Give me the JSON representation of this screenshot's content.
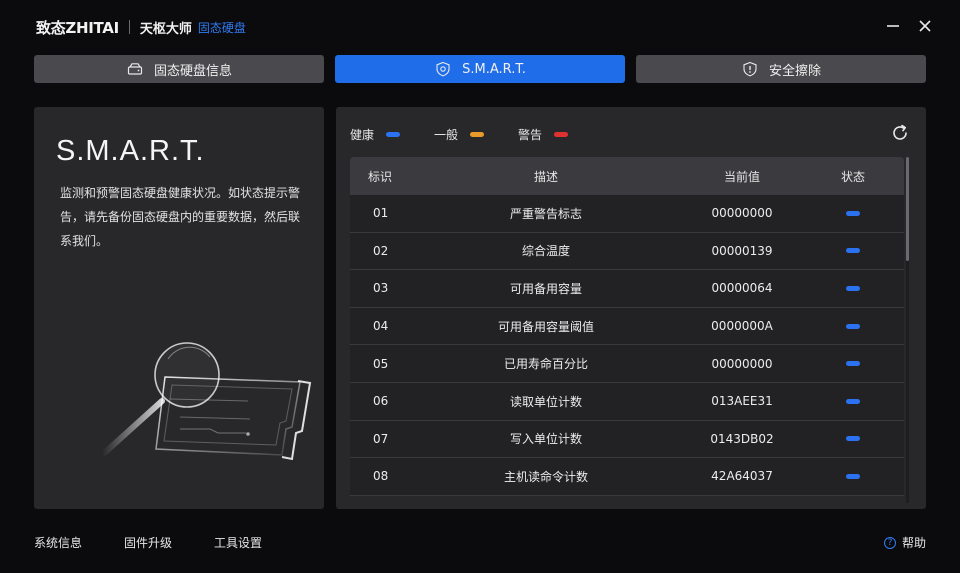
{
  "header": {
    "brand_logo": "致态ZHITAI",
    "product": "天枢大师",
    "subtitle": "固态硬盘",
    "accent_color": "#2f7bf2"
  },
  "tabs": [
    {
      "label": "固态硬盘信息",
      "icon": "drive-icon",
      "active": false
    },
    {
      "label": "S.M.A.R.T.",
      "icon": "shield-icon",
      "active": true
    },
    {
      "label": "安全擦除",
      "icon": "shield-alert-icon",
      "active": false
    }
  ],
  "left": {
    "title": "S.M.A.R.T.",
    "description": "监测和预警固态硬盘健康状况。如状态提示警告，请先备份固态硬盘内的重要数据，然后联系我们。"
  },
  "legend": [
    {
      "label": "健康",
      "color": "#2a72f0"
    },
    {
      "label": "一般",
      "color": "#e89a2a"
    },
    {
      "label": "警告",
      "color": "#e03131"
    }
  ],
  "table": {
    "headers": {
      "id": "标识",
      "desc": "描述",
      "value": "当前值",
      "status": "状态"
    },
    "rows": [
      {
        "id": "01",
        "desc": "严重警告标志",
        "value": "00000000",
        "status": "health"
      },
      {
        "id": "02",
        "desc": "综合温度",
        "value": "00000139",
        "status": "health"
      },
      {
        "id": "03",
        "desc": "可用备用容量",
        "value": "00000064",
        "status": "health"
      },
      {
        "id": "04",
        "desc": "可用备用容量阈值",
        "value": "0000000A",
        "status": "health"
      },
      {
        "id": "05",
        "desc": "已用寿命百分比",
        "value": "00000000",
        "status": "health"
      },
      {
        "id": "06",
        "desc": "读取单位计数",
        "value": "013AEE31",
        "status": "health"
      },
      {
        "id": "07",
        "desc": "写入单位计数",
        "value": "0143DB02",
        "status": "health"
      },
      {
        "id": "08",
        "desc": "主机读命令计数",
        "value": "42A64037",
        "status": "health"
      }
    ]
  },
  "footer": {
    "system_info": "系统信息",
    "firmware_upgrade": "固件升级",
    "tool_settings": "工具设置",
    "help": "帮助"
  }
}
